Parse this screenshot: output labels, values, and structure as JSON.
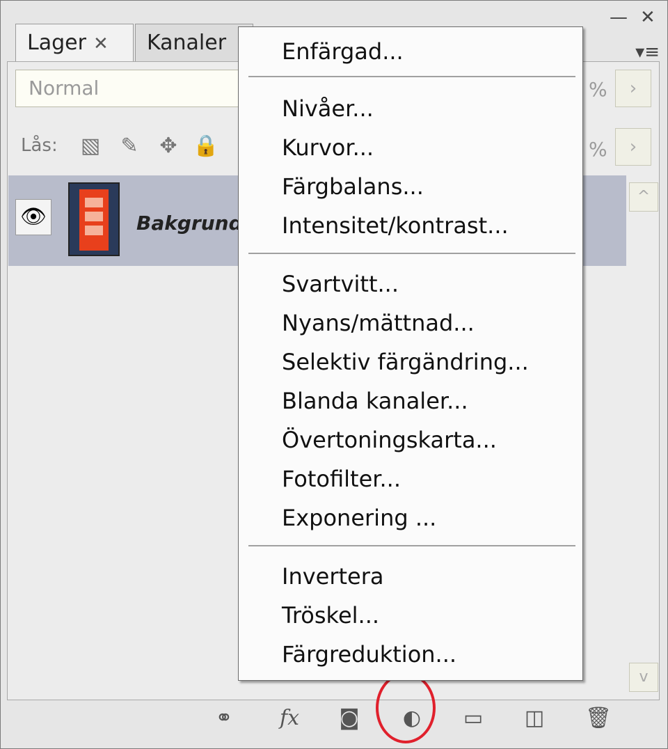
{
  "window": {
    "minimize_glyph": "—",
    "close_glyph": "✕",
    "panel_menu_glyph": "▾≡"
  },
  "tabs": [
    {
      "label": "Lager",
      "close": "✕"
    },
    {
      "label": "Kanaler"
    }
  ],
  "blend": {
    "value": "Normal",
    "opacity_suffix": "%",
    "fill_suffix": "%",
    "arrow": "›"
  },
  "lock": {
    "label": "Lås:"
  },
  "layer": {
    "name": "Bakgrund",
    "eye": "👁"
  },
  "menu": {
    "items": [
      "Enfärgad...",
      "Nivåer...",
      "Kurvor...",
      "Färgbalans...",
      "Intensitet/kontrast...",
      "Svartvitt...",
      "Nyans/mättnad...",
      "Selektiv färgändring...",
      "Blanda kanaler...",
      "Övertoningskarta...",
      "Fotofilter...",
      "Exponering ...",
      "Invertera",
      "Tröskel...",
      "Färgreduktion..."
    ]
  },
  "bottom_icons": [
    "link-icon",
    "fx-icon",
    "mask-icon",
    "adjustment-layer-icon",
    "folder-icon",
    "new-layer-icon",
    "trash-icon"
  ],
  "colors": {
    "highlight_circle": "#e0202c",
    "layer_selected": "#b8bccb"
  }
}
